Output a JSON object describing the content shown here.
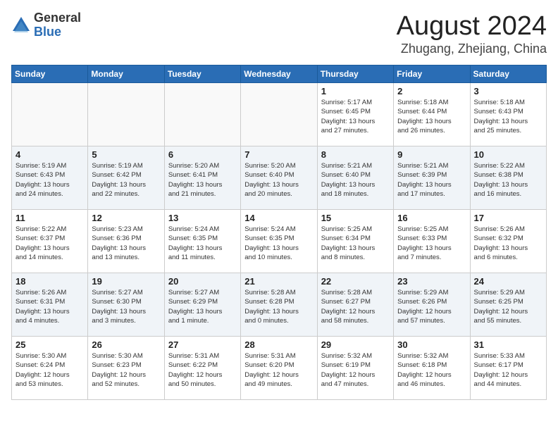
{
  "logo": {
    "general": "General",
    "blue": "Blue"
  },
  "title": "August 2024",
  "location": "Zhugang, Zhejiang, China",
  "days_of_week": [
    "Sunday",
    "Monday",
    "Tuesday",
    "Wednesday",
    "Thursday",
    "Friday",
    "Saturday"
  ],
  "weeks": [
    [
      {
        "day": "",
        "info": ""
      },
      {
        "day": "",
        "info": ""
      },
      {
        "day": "",
        "info": ""
      },
      {
        "day": "",
        "info": ""
      },
      {
        "day": "1",
        "info": "Sunrise: 5:17 AM\nSunset: 6:45 PM\nDaylight: 13 hours\nand 27 minutes."
      },
      {
        "day": "2",
        "info": "Sunrise: 5:18 AM\nSunset: 6:44 PM\nDaylight: 13 hours\nand 26 minutes."
      },
      {
        "day": "3",
        "info": "Sunrise: 5:18 AM\nSunset: 6:43 PM\nDaylight: 13 hours\nand 25 minutes."
      }
    ],
    [
      {
        "day": "4",
        "info": "Sunrise: 5:19 AM\nSunset: 6:43 PM\nDaylight: 13 hours\nand 24 minutes."
      },
      {
        "day": "5",
        "info": "Sunrise: 5:19 AM\nSunset: 6:42 PM\nDaylight: 13 hours\nand 22 minutes."
      },
      {
        "day": "6",
        "info": "Sunrise: 5:20 AM\nSunset: 6:41 PM\nDaylight: 13 hours\nand 21 minutes."
      },
      {
        "day": "7",
        "info": "Sunrise: 5:20 AM\nSunset: 6:40 PM\nDaylight: 13 hours\nand 20 minutes."
      },
      {
        "day": "8",
        "info": "Sunrise: 5:21 AM\nSunset: 6:40 PM\nDaylight: 13 hours\nand 18 minutes."
      },
      {
        "day": "9",
        "info": "Sunrise: 5:21 AM\nSunset: 6:39 PM\nDaylight: 13 hours\nand 17 minutes."
      },
      {
        "day": "10",
        "info": "Sunrise: 5:22 AM\nSunset: 6:38 PM\nDaylight: 13 hours\nand 16 minutes."
      }
    ],
    [
      {
        "day": "11",
        "info": "Sunrise: 5:22 AM\nSunset: 6:37 PM\nDaylight: 13 hours\nand 14 minutes."
      },
      {
        "day": "12",
        "info": "Sunrise: 5:23 AM\nSunset: 6:36 PM\nDaylight: 13 hours\nand 13 minutes."
      },
      {
        "day": "13",
        "info": "Sunrise: 5:24 AM\nSunset: 6:35 PM\nDaylight: 13 hours\nand 11 minutes."
      },
      {
        "day": "14",
        "info": "Sunrise: 5:24 AM\nSunset: 6:35 PM\nDaylight: 13 hours\nand 10 minutes."
      },
      {
        "day": "15",
        "info": "Sunrise: 5:25 AM\nSunset: 6:34 PM\nDaylight: 13 hours\nand 8 minutes."
      },
      {
        "day": "16",
        "info": "Sunrise: 5:25 AM\nSunset: 6:33 PM\nDaylight: 13 hours\nand 7 minutes."
      },
      {
        "day": "17",
        "info": "Sunrise: 5:26 AM\nSunset: 6:32 PM\nDaylight: 13 hours\nand 6 minutes."
      }
    ],
    [
      {
        "day": "18",
        "info": "Sunrise: 5:26 AM\nSunset: 6:31 PM\nDaylight: 13 hours\nand 4 minutes."
      },
      {
        "day": "19",
        "info": "Sunrise: 5:27 AM\nSunset: 6:30 PM\nDaylight: 13 hours\nand 3 minutes."
      },
      {
        "day": "20",
        "info": "Sunrise: 5:27 AM\nSunset: 6:29 PM\nDaylight: 13 hours\nand 1 minute."
      },
      {
        "day": "21",
        "info": "Sunrise: 5:28 AM\nSunset: 6:28 PM\nDaylight: 13 hours\nand 0 minutes."
      },
      {
        "day": "22",
        "info": "Sunrise: 5:28 AM\nSunset: 6:27 PM\nDaylight: 12 hours\nand 58 minutes."
      },
      {
        "day": "23",
        "info": "Sunrise: 5:29 AM\nSunset: 6:26 PM\nDaylight: 12 hours\nand 57 minutes."
      },
      {
        "day": "24",
        "info": "Sunrise: 5:29 AM\nSunset: 6:25 PM\nDaylight: 12 hours\nand 55 minutes."
      }
    ],
    [
      {
        "day": "25",
        "info": "Sunrise: 5:30 AM\nSunset: 6:24 PM\nDaylight: 12 hours\nand 53 minutes."
      },
      {
        "day": "26",
        "info": "Sunrise: 5:30 AM\nSunset: 6:23 PM\nDaylight: 12 hours\nand 52 minutes."
      },
      {
        "day": "27",
        "info": "Sunrise: 5:31 AM\nSunset: 6:22 PM\nDaylight: 12 hours\nand 50 minutes."
      },
      {
        "day": "28",
        "info": "Sunrise: 5:31 AM\nSunset: 6:20 PM\nDaylight: 12 hours\nand 49 minutes."
      },
      {
        "day": "29",
        "info": "Sunrise: 5:32 AM\nSunset: 6:19 PM\nDaylight: 12 hours\nand 47 minutes."
      },
      {
        "day": "30",
        "info": "Sunrise: 5:32 AM\nSunset: 6:18 PM\nDaylight: 12 hours\nand 46 minutes."
      },
      {
        "day": "31",
        "info": "Sunrise: 5:33 AM\nSunset: 6:17 PM\nDaylight: 12 hours\nand 44 minutes."
      }
    ]
  ]
}
